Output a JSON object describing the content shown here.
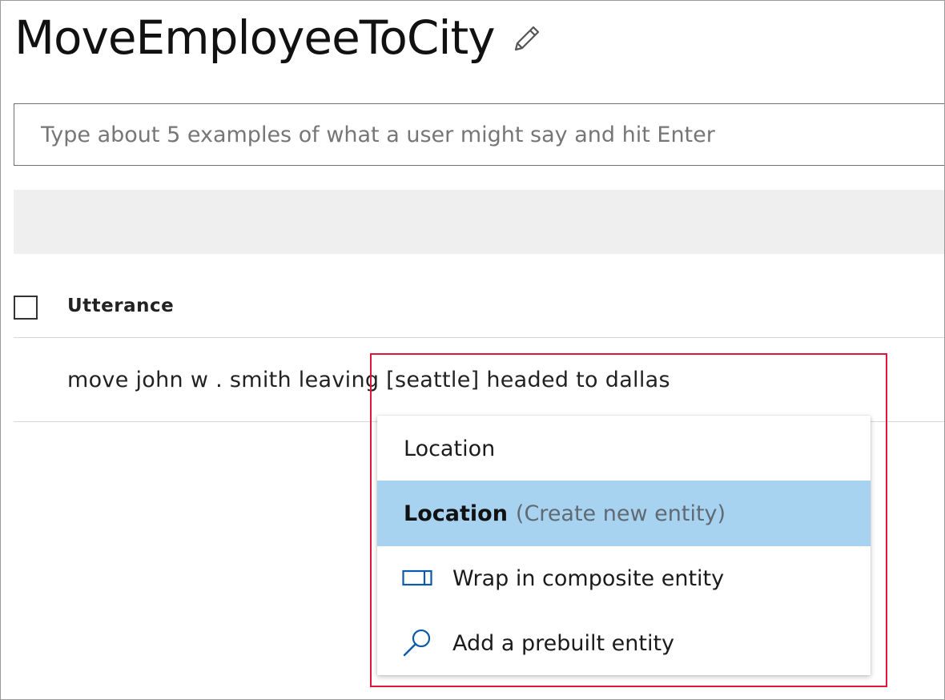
{
  "header": {
    "title": "MoveEmployeeToCity",
    "edit_icon": "pencil-icon"
  },
  "input": {
    "placeholder": "Type about 5 examples of what a user might say and hit Enter",
    "value": ""
  },
  "table": {
    "columns": [
      "Utterance"
    ],
    "rows": [
      {
        "utterance": "move john w . smith leaving [seattle] headed to dallas"
      }
    ]
  },
  "entity_menu": {
    "items": [
      {
        "label": "Location",
        "hint": "",
        "icon": ""
      },
      {
        "label": "Location",
        "hint": "(Create new entity)",
        "icon": ""
      },
      {
        "label": "Wrap in composite entity",
        "hint": "",
        "icon": "composite-entity-icon"
      },
      {
        "label": "Add a prebuilt entity",
        "hint": "",
        "icon": "search-icon"
      }
    ]
  },
  "colors": {
    "selected_item_bg": "#a7d3f1",
    "highlight_border": "#e0163c",
    "icon_blue": "#0f5aa8",
    "toolbar_bg": "#efefef"
  }
}
